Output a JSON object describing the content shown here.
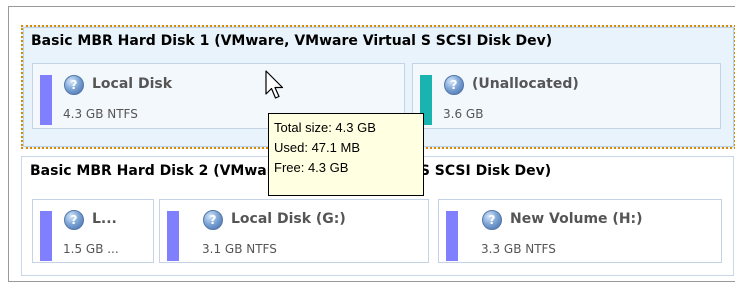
{
  "disks": [
    {
      "title": "Basic MBR Hard Disk 1 (VMware, VMware Virtual S SCSI Disk Dev)",
      "partitions": [
        {
          "name": "Local Disk",
          "size": "4.3 GB NTFS",
          "bar_color": "#8080ff",
          "icon": "disk-info-icon"
        },
        {
          "name": "(Unallocated)",
          "size": "3.6 GB",
          "bar_color": "#19b3b0",
          "icon": "disk-info-icon"
        }
      ]
    },
    {
      "title": "Basic MBR Hard Disk 2 (VMware, VMware Virtual S SCSI Disk Dev)",
      "partitions": [
        {
          "name": "L...",
          "size": "1.5 GB ...",
          "bar_color": "#8080ff",
          "icon": "disk-info-icon"
        },
        {
          "name": "Local Disk (G:)",
          "size": "3.1 GB NTFS",
          "bar_color": "#8080ff",
          "icon": "disk-info-icon"
        },
        {
          "name": "New Volume (H:)",
          "size": "3.3 GB NTFS",
          "bar_color": "#8080ff",
          "icon": "disk-info-icon"
        }
      ]
    }
  ],
  "tooltip": {
    "total": "Total size: 4.3 GB",
    "used": "Used: 47.1 MB",
    "free": "Free: 4.3 GB"
  },
  "cursor": "arrow-cursor-icon"
}
